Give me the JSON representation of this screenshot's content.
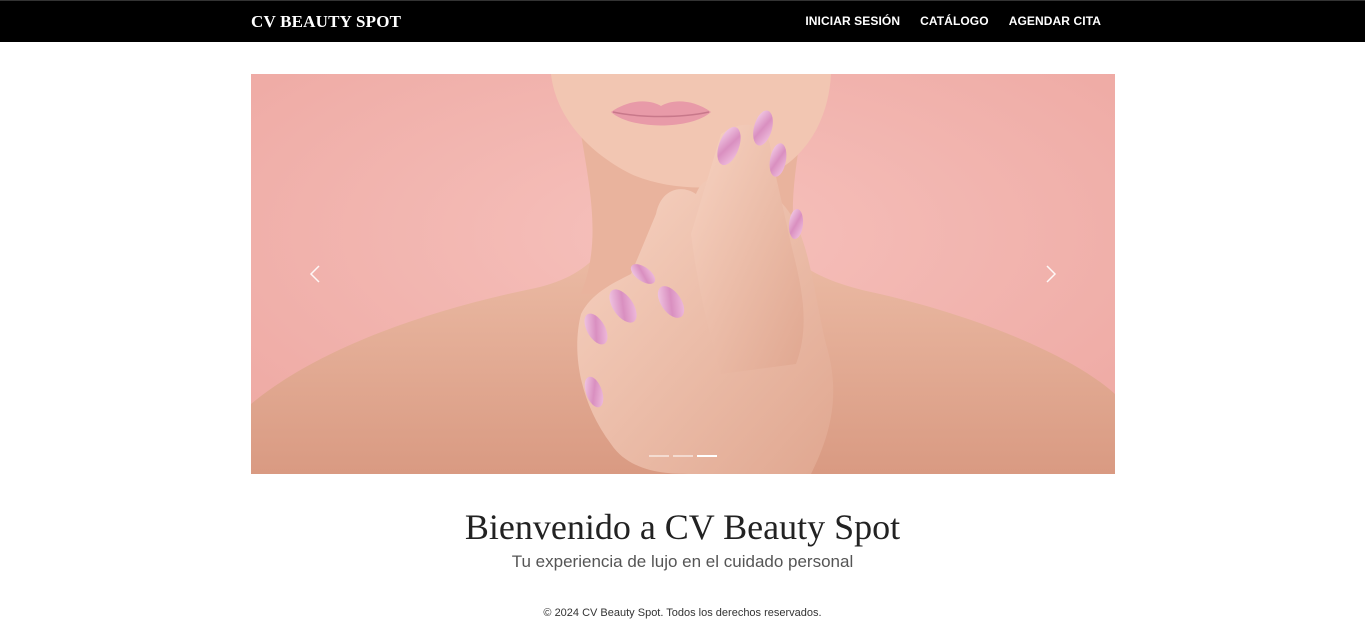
{
  "navbar": {
    "brand": "CV BEAUTY SPOT",
    "links": [
      "INICIAR SESIÓN",
      "CATÁLOGO",
      "AGENDAR CITA"
    ]
  },
  "carousel": {
    "prev_icon": "chevron-left-icon",
    "next_icon": "chevron-right-icon",
    "slide_count": 3,
    "active_index": 2
  },
  "welcome": {
    "title": "Bienvenido a CV Beauty Spot",
    "subtitle": "Tu experiencia de lujo en el cuidado personal"
  },
  "footer": {
    "text": "© 2024 CV Beauty Spot. Todos los derechos reservados."
  },
  "colors": {
    "navbar_bg": "#000000",
    "hero_bg": "#f2b2ad",
    "text_dark": "#222222"
  }
}
